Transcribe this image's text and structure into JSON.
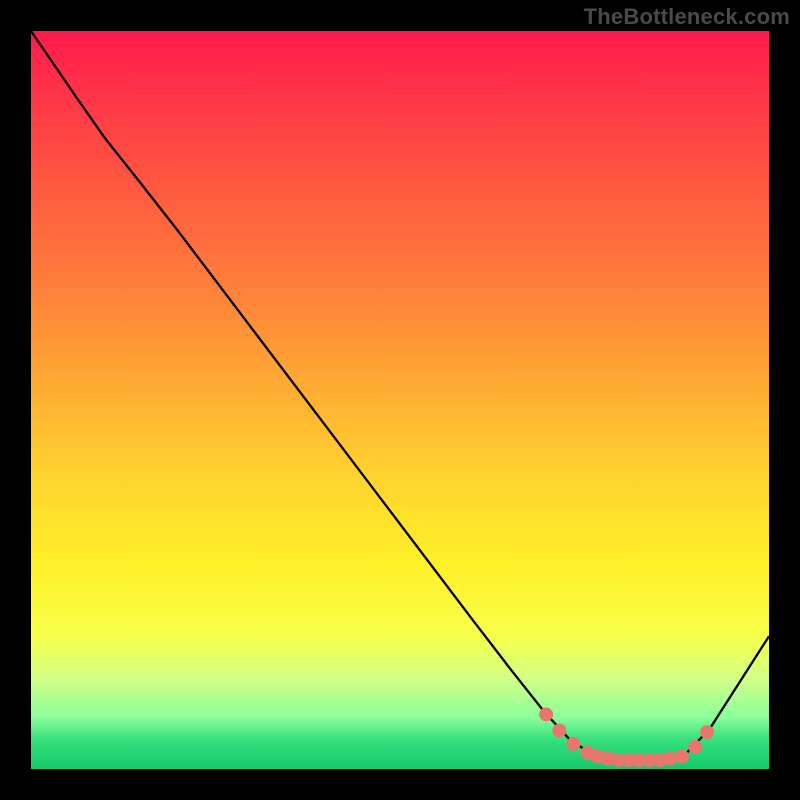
{
  "watermark": "TheBottleneck.com",
  "colors": {
    "background": "#000000",
    "curve": "#000000",
    "dot": "#e9766c",
    "gradient_top": "#ff1a4d",
    "gradient_bottom": "#16c86a"
  },
  "chart_data": {
    "type": "line",
    "title": "",
    "xlabel": "",
    "ylabel": "",
    "xlim": [
      0,
      1
    ],
    "ylim": [
      0,
      1
    ],
    "curve": [
      {
        "x": 0.0,
        "y": 1.0
      },
      {
        "x": 0.065,
        "y": 0.905
      },
      {
        "x": 0.1,
        "y": 0.855
      },
      {
        "x": 0.15,
        "y": 0.792
      },
      {
        "x": 0.2,
        "y": 0.728
      },
      {
        "x": 0.3,
        "y": 0.596
      },
      {
        "x": 0.4,
        "y": 0.464
      },
      {
        "x": 0.5,
        "y": 0.332
      },
      {
        "x": 0.6,
        "y": 0.2
      },
      {
        "x": 0.65,
        "y": 0.135
      },
      {
        "x": 0.695,
        "y": 0.078
      },
      {
        "x": 0.73,
        "y": 0.04
      },
      {
        "x": 0.76,
        "y": 0.02
      },
      {
        "x": 0.8,
        "y": 0.012
      },
      {
        "x": 0.85,
        "y": 0.012
      },
      {
        "x": 0.885,
        "y": 0.018
      },
      {
        "x": 0.92,
        "y": 0.055
      },
      {
        "x": 1.0,
        "y": 0.18
      }
    ],
    "highlight_points": [
      {
        "x": 0.698,
        "y": 0.074
      },
      {
        "x": 0.716,
        "y": 0.052
      },
      {
        "x": 0.735,
        "y": 0.034
      },
      {
        "x": 0.754,
        "y": 0.022
      },
      {
        "x": 0.768,
        "y": 0.017
      },
      {
        "x": 0.782,
        "y": 0.014
      },
      {
        "x": 0.796,
        "y": 0.012
      },
      {
        "x": 0.81,
        "y": 0.012
      },
      {
        "x": 0.824,
        "y": 0.012
      },
      {
        "x": 0.838,
        "y": 0.012
      },
      {
        "x": 0.852,
        "y": 0.012
      },
      {
        "x": 0.866,
        "y": 0.014
      },
      {
        "x": 0.882,
        "y": 0.017
      },
      {
        "x": 0.9,
        "y": 0.03
      },
      {
        "x": 0.916,
        "y": 0.05
      }
    ],
    "highlight_radius_norm": 0.0095
  }
}
